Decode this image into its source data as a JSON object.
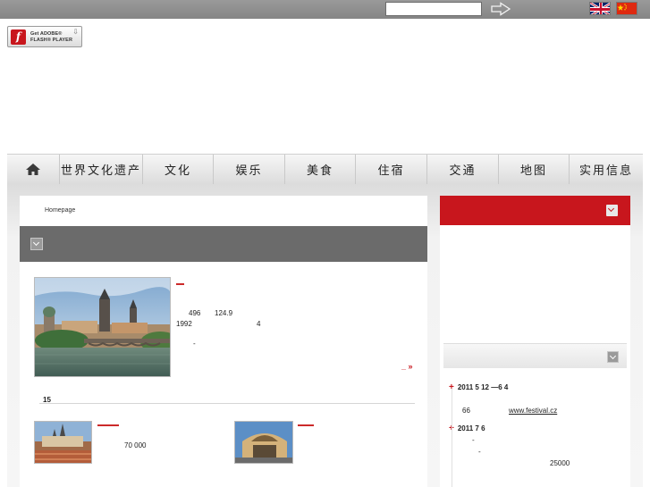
{
  "topbar": {
    "search_value": "",
    "search_placeholder": "",
    "go_icon": "arrow-right-outline-icon",
    "languages": [
      "english-flag-icon",
      "chinese-flag-icon"
    ]
  },
  "flash": {
    "line1": "Get ADOBE®",
    "line2": "FLASH® PLAYER"
  },
  "nav": {
    "home_icon": "home-icon",
    "items": [
      "世界文化遗产",
      "文化",
      "娱乐",
      "美食",
      "住宿",
      "交通",
      "地图",
      "实用信息"
    ]
  },
  "main": {
    "breadcrumb": "Homepage",
    "feature": {
      "line1_a": "496",
      "line1_b": "124.9",
      "line2_a": "1992",
      "line2_b": "4",
      "line3": "-",
      "more": "_ »"
    },
    "list_count": "15",
    "thumb1_text": "70 000"
  },
  "sidebar": {
    "events": [
      {
        "date": "2011  5  12  —6  4",
        "extra": "66",
        "link": "www.festival.cz"
      },
      {
        "date": "2011  7  6",
        "line1": "-",
        "line2": "-",
        "value": "25000"
      }
    ]
  },
  "colors": {
    "accent_red": "#c8161d",
    "header_grey": "#6b6b6b",
    "topbar_grey": "#8e8e8e"
  }
}
